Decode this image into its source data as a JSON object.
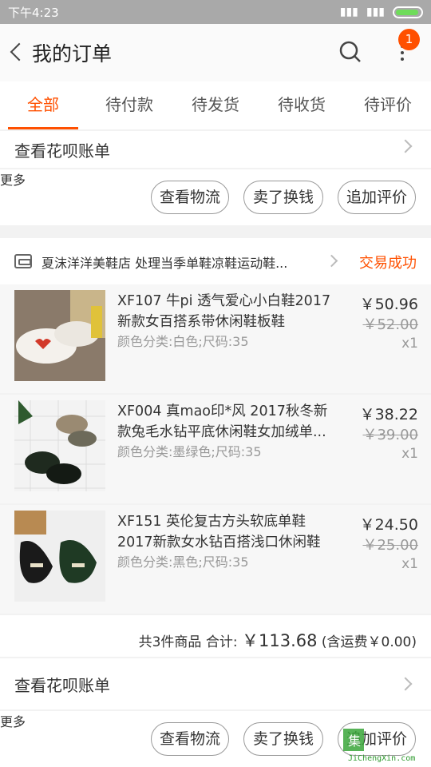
{
  "status_bar": {
    "time": "下午4:23"
  },
  "header": {
    "title": "我的订单",
    "badge_count": "1"
  },
  "tabs": [
    {
      "label": "全部",
      "active": true
    },
    {
      "label": "待付款"
    },
    {
      "label": "待发货"
    },
    {
      "label": "待收货"
    },
    {
      "label": "待评价"
    }
  ],
  "huabei_label": "查看花呗账单",
  "actions": {
    "more": "更多",
    "logistics": "查看物流",
    "resell": "卖了换钱",
    "review": "追加评价"
  },
  "order": {
    "shop": "夏沫洋洋美鞋店 处理当季单鞋凉鞋运动鞋...",
    "status": "交易成功",
    "items": [
      {
        "title": "XF107 牛pi 透气爱心小白鞋2017新款女百搭系带休闲鞋板鞋",
        "sku": "颜色分类:白色;尺码:35",
        "price": "￥50.96",
        "original_price": "￥52.00",
        "qty": "x1"
      },
      {
        "title": "XF004 真mao印*风 2017秋冬新款兔毛水钻平底休闲鞋女加绒单...",
        "sku": "颜色分类:墨绿色;尺码:35",
        "price": "￥38.22",
        "original_price": "￥39.00",
        "qty": "x1"
      },
      {
        "title": "XF151 英伦复古方头软底单鞋2017新款女水钻百搭浅口休闲鞋",
        "sku": "颜色分类:黑色;尺码:35",
        "price": "￥24.50",
        "original_price": "￥25.00",
        "qty": "x1"
      }
    ],
    "summary_count": "共3件商品",
    "summary_total_label": "合计:",
    "summary_total": "￥113.68",
    "summary_shipping": "(含运费￥0.00)"
  },
  "watermark": {
    "url": "JiChengXin.com"
  },
  "colors": {
    "accent": "#ff5000"
  }
}
